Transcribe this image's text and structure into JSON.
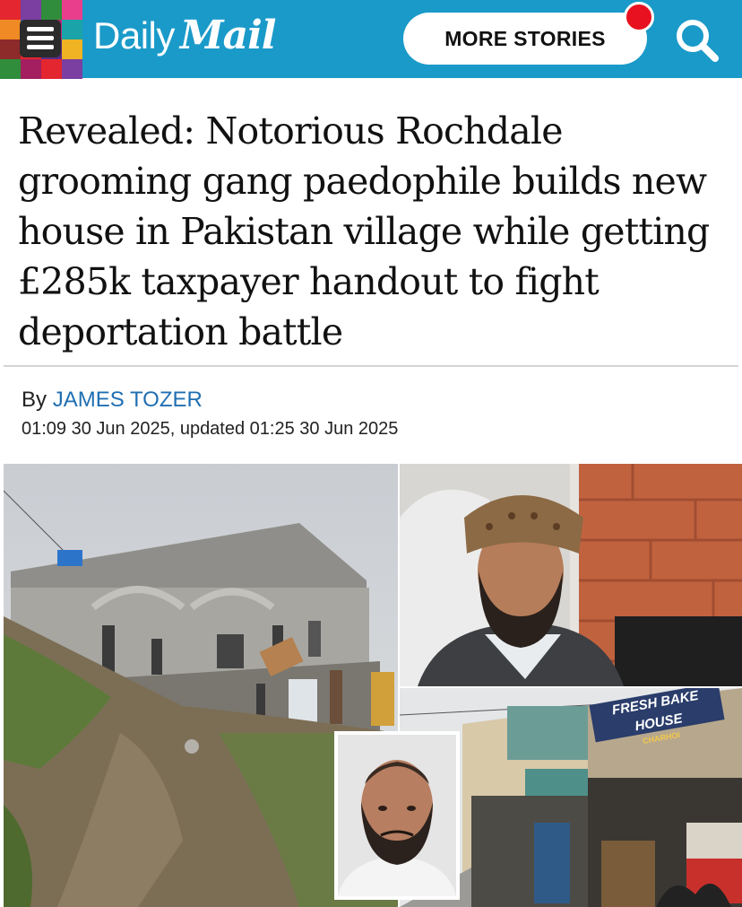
{
  "header": {
    "logo_daily": "Daily",
    "logo_mail": "Mail",
    "more_stories_label": "MORE STORIES",
    "icons": {
      "menu": "hamburger-menu-icon",
      "search": "search-icon",
      "notification": "notification-dot-icon"
    },
    "colors": {
      "bar": "#1a9ac9",
      "notification": "#e8111f"
    }
  },
  "article": {
    "headline": "Revealed: Notorious Rochdale grooming gang paedophile builds new house in Pakistan village while getting £285k taxpayer handout to fight deportation battle",
    "byline_prefix": "By",
    "author": "JAMES TOZER",
    "dateline": "01:09 30 Jun 2025, updated 01:25 30 Jun 2025"
  },
  "images": {
    "shop_sign": "FRESH BAKE HOUSE",
    "shop_sign_sub": "CHARHOI"
  }
}
